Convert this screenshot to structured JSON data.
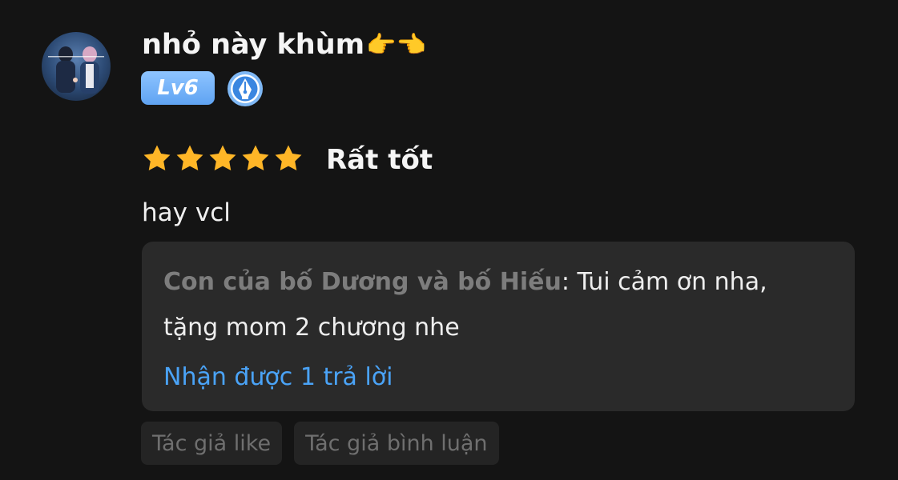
{
  "user": {
    "name": "nhỏ này khùm",
    "name_emoji": "👉👈",
    "level": "Lv6",
    "avatar_icon": "avatar-photo",
    "badge_icon": "pen-nib-icon"
  },
  "review": {
    "stars": 5,
    "max_stars": 5,
    "rating_label": "Rất tốt",
    "comment": "hay vcl"
  },
  "reply": {
    "author": "Con của bố Dương và bố Hiếu",
    "separator": ": ",
    "text": "Tui cảm ơn nha, tặng mom 2 chương nhe",
    "replies_link": "Nhận được 1 trả lời"
  },
  "chips": {
    "author_like": "Tác giả like",
    "author_comment": "Tác giả bình luận"
  },
  "colors": {
    "background": "#141414",
    "star": "#ffb627",
    "level_badge": "#6fb0f7",
    "link": "#4aa3f7",
    "reply_box": "#2a2a2a",
    "muted_text": "#7d7d7d"
  }
}
